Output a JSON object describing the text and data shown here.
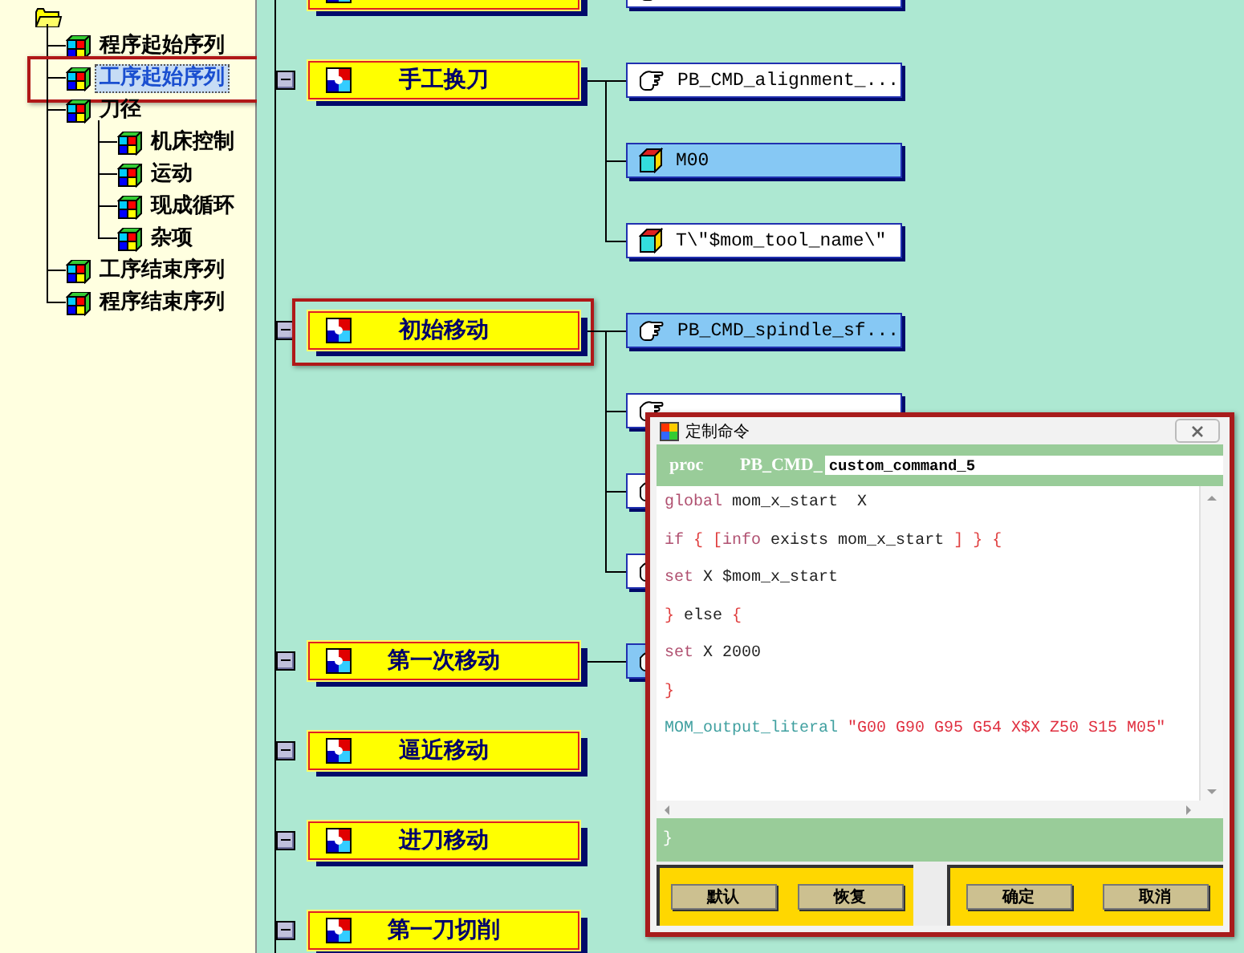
{
  "tree": {
    "root": {
      "expanded": true
    },
    "items": [
      {
        "label": "程序起始序列",
        "selected": false,
        "highlighted": false
      },
      {
        "label": "工序起始序列",
        "selected": true,
        "highlighted": true
      },
      {
        "label": "刀径",
        "selected": false,
        "highlighted": false,
        "children": [
          {
            "label": "机床控制",
            "selected": false,
            "highlighted": false
          },
          {
            "label": "运动",
            "selected": false,
            "highlighted": false
          },
          {
            "label": "现成循环",
            "selected": false,
            "highlighted": false
          },
          {
            "label": "杂项",
            "selected": false,
            "highlighted": false
          }
        ]
      },
      {
        "label": "工序结束序列",
        "selected": false,
        "highlighted": false
      },
      {
        "label": "程序结束序列",
        "selected": false,
        "highlighted": false
      }
    ]
  },
  "events": [
    {
      "commands": [
        {
          "kind": "hand",
          "selected": false
        }
      ]
    },
    {
      "label": "手工换刀",
      "expanded": true,
      "highlighted": false,
      "commands": [
        {
          "kind": "hand",
          "label": "PB_CMD_alignment_...",
          "selected": false
        },
        {
          "kind": "cube",
          "label": "M00",
          "selected": true
        },
        {
          "kind": "cube",
          "label": "T\\\"$mom_tool_name\\\"",
          "selected": false
        }
      ]
    },
    {
      "label": "初始移动",
      "expanded": true,
      "highlighted": true,
      "commands": [
        {
          "kind": "hand",
          "label": "PB_CMD_spindle_sf...",
          "selected": true
        },
        {
          "kind": "hand",
          "selected": false
        },
        {
          "kind": "hand",
          "selected": false
        },
        {
          "kind": "hand",
          "selected": false
        }
      ]
    },
    {
      "label": "第一次移动",
      "expanded": true,
      "highlighted": false,
      "commands": [
        {
          "kind": "hand",
          "selected": true
        }
      ]
    },
    {
      "label": "逼近移动",
      "expanded": true,
      "highlighted": false
    },
    {
      "label": "进刀移动",
      "expanded": true,
      "highlighted": false
    },
    {
      "label": "第一刀切削",
      "expanded": true,
      "highlighted": false
    }
  ],
  "dialog": {
    "title": "定制命令",
    "highlighted": true,
    "proc_keyword": "proc",
    "prefix": "PB_CMD_",
    "name_value": "custom_command_5",
    "lines": [
      {
        "tokens": [
          {
            "kind": "keyword",
            "text": "global"
          },
          {
            "kind": "plain",
            "text": " mom_x_start  X"
          }
        ]
      },
      {
        "tokens": [
          {
            "kind": "keyword",
            "text": "if"
          },
          {
            "kind": "brace",
            "text": " { ["
          },
          {
            "kind": "keyword",
            "text": "info"
          },
          {
            "kind": "plain",
            "text": " exists mom_x_start "
          },
          {
            "kind": "brace",
            "text": "] } {"
          }
        ]
      },
      {
        "tokens": [
          {
            "kind": "keyword",
            "text": "set"
          },
          {
            "kind": "plain",
            "text": " X $mom_x_start"
          }
        ]
      },
      {
        "tokens": [
          {
            "kind": "brace",
            "text": "} "
          },
          {
            "kind": "plain",
            "text": "else "
          },
          {
            "kind": "brace",
            "text": "{"
          }
        ]
      },
      {
        "tokens": [
          {
            "kind": "keyword",
            "text": "set"
          },
          {
            "kind": "plain",
            "text": " X 2000"
          }
        ]
      },
      {
        "tokens": [
          {
            "kind": "brace",
            "text": "}"
          }
        ]
      },
      {
        "tokens": [
          {
            "kind": "command",
            "text": "MOM_output_literal"
          },
          {
            "kind": "string",
            "text": " \"G00 G90 G95 G54 X$X Z50 S15 M05\""
          }
        ]
      }
    ],
    "closing": "}",
    "button_groups": [
      [
        "默认",
        "恢复"
      ],
      [
        "确定",
        "取消"
      ]
    ]
  }
}
